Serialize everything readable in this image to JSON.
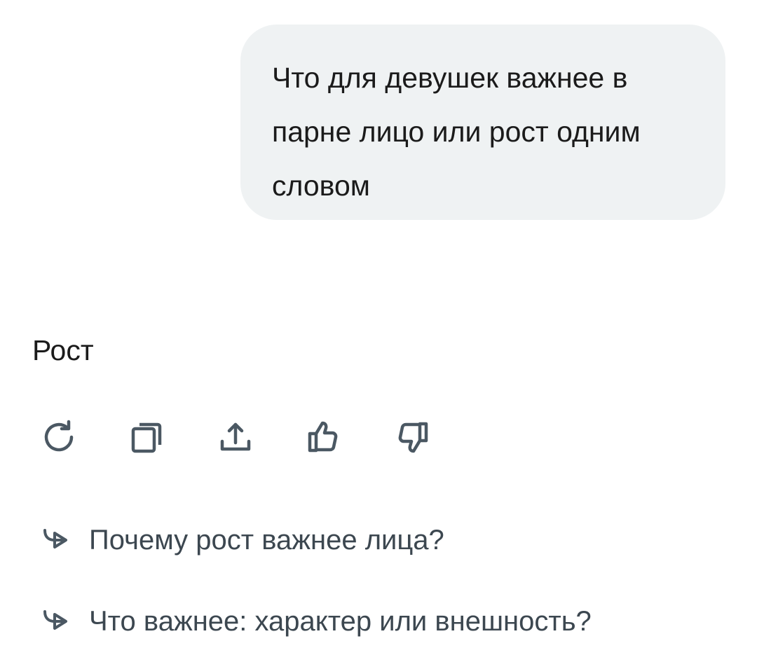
{
  "user_message": {
    "text": "Что для девушек важнее в парне лицо или рост одним словом"
  },
  "assistant_message": {
    "text": "Рост"
  },
  "actions": [
    {
      "icon": "regenerate-icon"
    },
    {
      "icon": "copy-icon"
    },
    {
      "icon": "share-icon"
    },
    {
      "icon": "thumbs-up-icon"
    },
    {
      "icon": "thumbs-down-icon"
    }
  ],
  "suggestions": [
    {
      "icon": "follow-up-arrow-icon",
      "text": "Почему рост важнее лица?"
    },
    {
      "icon": "follow-up-arrow-icon",
      "text": "Что важнее: характер или внешность?"
    }
  ],
  "colors": {
    "bubble_background": "#eff2f3",
    "text": "#1b1b1b",
    "icon": "#4b5863",
    "suggestion_text": "#3c4750"
  }
}
